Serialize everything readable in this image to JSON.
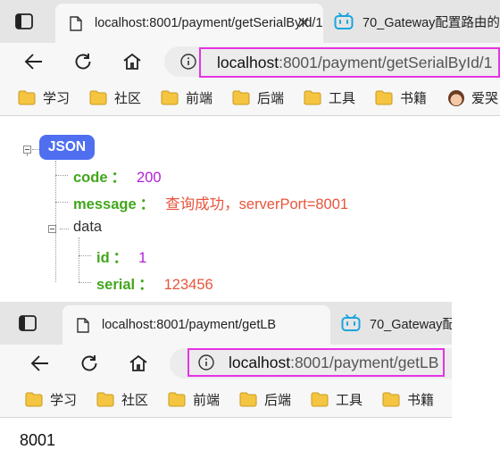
{
  "window1": {
    "tab_active_title": "localhost:8001/payment/getSerialById/1",
    "tab2_title": "70_Gateway配置路由的",
    "url_host": "localhost",
    "url_rest": ":8001/payment/getSerialById/1",
    "bookmarks": [
      "学习",
      "社区",
      "前端",
      "后端",
      "工具",
      "书籍",
      "爱哭"
    ]
  },
  "json_view": {
    "badge": "JSON",
    "code_key": "code",
    "code_value": "200",
    "message_key": "message",
    "message_value": "查询成功，serverPort=8001",
    "data_key": "data",
    "id_key": "id",
    "id_value": "1",
    "serial_key": "serial",
    "serial_value": "123456",
    "colon": "："
  },
  "window2": {
    "tab_active_title": "localhost:8001/payment/getLB",
    "tab2_title": "70_Gateway配",
    "url_host": "localhost",
    "url_rest": ":8001/payment/getLB",
    "bookmarks": [
      "学习",
      "社区",
      "前端",
      "后端",
      "工具",
      "书籍"
    ]
  },
  "page2_body": "8001",
  "colors": {
    "highlight_box": "#e633e6",
    "json_badge": "#4f6ff0",
    "json_key": "#43a61c",
    "json_number": "#b320d9",
    "json_string": "#e8543c",
    "folder": "#f5c542"
  }
}
